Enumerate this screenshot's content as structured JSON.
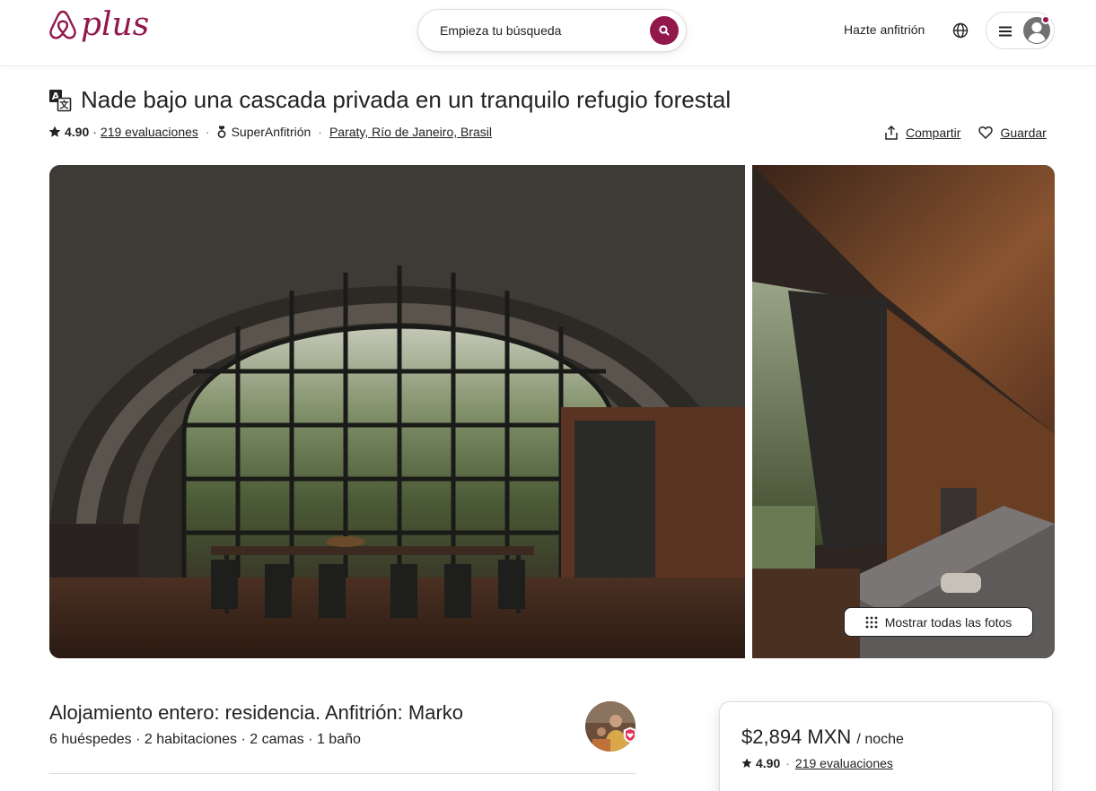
{
  "header": {
    "logo_text": "plus",
    "search_placeholder": "Empieza tu búsqueda",
    "host_link": "Hazte anfitrión",
    "brand_color": "#92174d"
  },
  "listing": {
    "title": "Nade bajo una cascada privada en un tranquilo refugio forestal",
    "rating": "4.90",
    "dot": "·",
    "reviews": "219 evaluaciones",
    "superhost": "SuperAnfitrión",
    "location": "Paraty, Río de Janeiro, Brasil",
    "share": "Compartir",
    "save": "Guardar"
  },
  "gallery": {
    "show_all": "Mostrar todas las fotos"
  },
  "summary": {
    "title": "Alojamiento entero: residencia. Anfitrión: Marko",
    "details": "6 huéspedes · 2 habitaciones · 2 camas · 1 baño"
  },
  "booking": {
    "price": "$2,894 MXN",
    "per_night": "/ noche",
    "rating": "4.90",
    "dot": "·",
    "reviews": "219 evaluaciones"
  }
}
